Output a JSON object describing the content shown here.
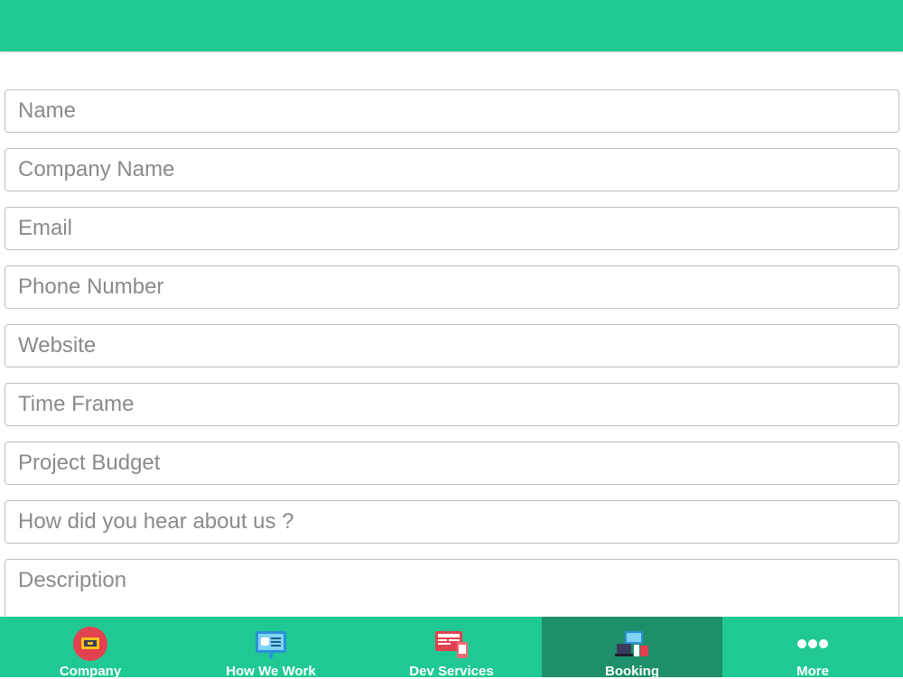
{
  "form": {
    "fields": [
      {
        "placeholder": "Name"
      },
      {
        "placeholder": "Company Name"
      },
      {
        "placeholder": "Email"
      },
      {
        "placeholder": "Phone Number"
      },
      {
        "placeholder": "Website"
      },
      {
        "placeholder": "Time Frame"
      },
      {
        "placeholder": "Project Budget"
      },
      {
        "placeholder": "How did you hear about us ?"
      }
    ],
    "description_placeholder": "Description"
  },
  "tabbar": {
    "items": [
      {
        "label": "Company",
        "icon": "company-icon",
        "active": false
      },
      {
        "label": "How We Work",
        "icon": "presentation-icon",
        "active": false
      },
      {
        "label": "Dev Services",
        "icon": "dev-services-icon",
        "active": false
      },
      {
        "label": "Booking",
        "icon": "booking-icon",
        "active": true
      },
      {
        "label": "More",
        "icon": "more-dots-icon",
        "active": false
      }
    ]
  },
  "colors": {
    "primary": "#20c994",
    "active_tab": "#1e8f6a"
  }
}
